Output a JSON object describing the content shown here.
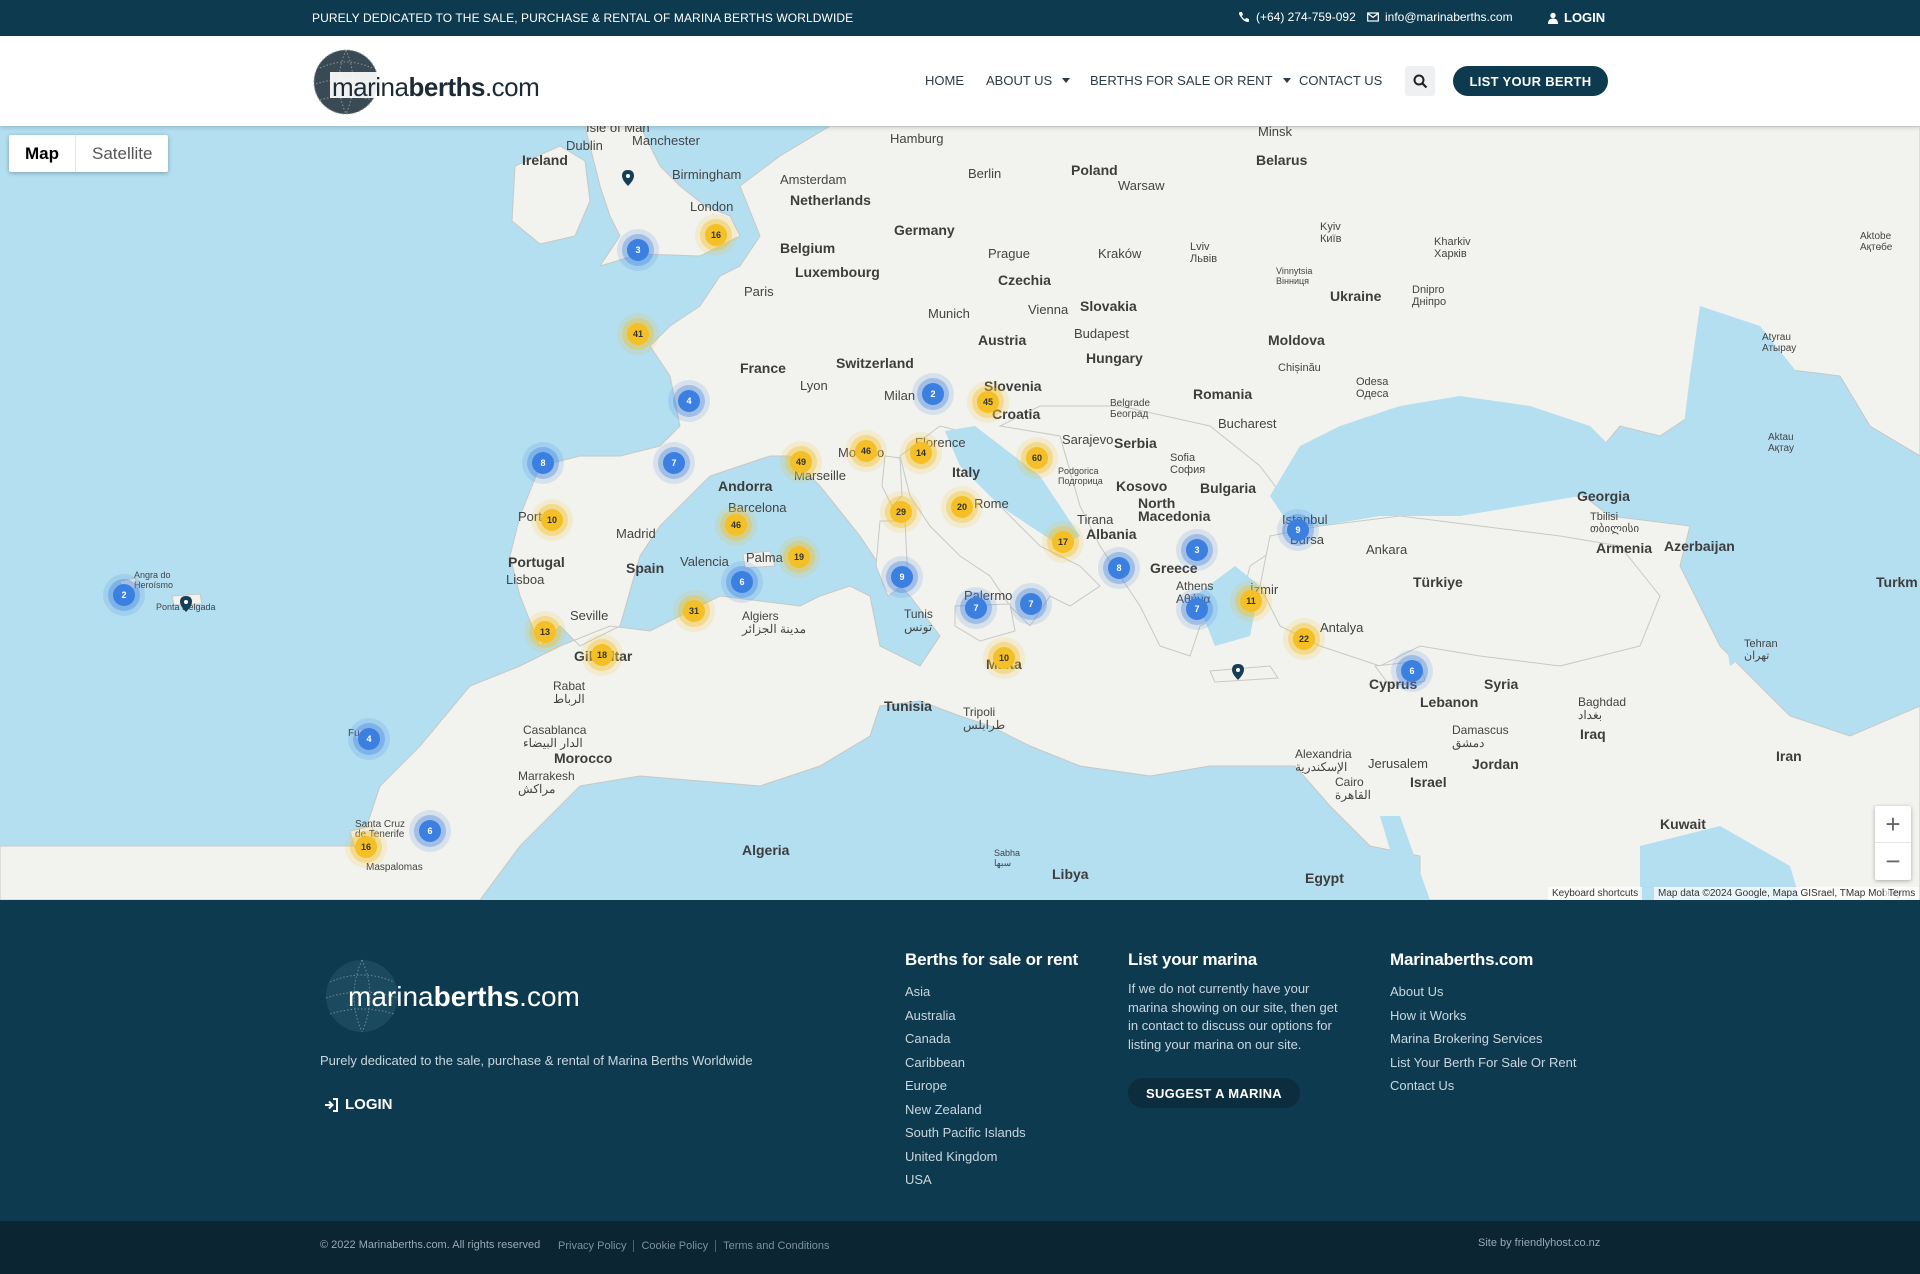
{
  "topbar": {
    "tagline": "PURELY DEDICATED TO THE SALE, PURCHASE & RENTAL OF MARINA BERTHS WORLDWIDE",
    "phone": "(+64) 274-759-092",
    "email": "info@marinaberths.com",
    "login": "LOGIN"
  },
  "header": {
    "logo_light": "marina",
    "logo_bold": "berths",
    "logo_tld": ".com",
    "nav": {
      "home": "HOME",
      "about": "ABOUT US",
      "berths": "BERTHS FOR SALE OR RENT",
      "contact": "CONTACT US"
    },
    "list_button": "LIST YOUR BERTH",
    "search_icon": "search-icon"
  },
  "map": {
    "map_type": {
      "map": "Map",
      "satellite": "Satellite"
    },
    "labels": {
      "ireland": "Ireland",
      "dublin": "Dublin",
      "birmingham": "Birmingham",
      "london": "London",
      "manchester": "Manchester",
      "isle_of_man": "Isle of Man",
      "amsterdam": "Amsterdam",
      "netherlands": "Netherlands",
      "hamburg": "Hamburg",
      "berlin": "Berlin",
      "poland": "Poland",
      "warsaw": "Warsaw",
      "minsk": "Minsk",
      "belarus": "Belarus",
      "belgium": "Belgium",
      "luxembourg": "Luxembourg",
      "germany": "Germany",
      "prague": "Prague",
      "czechia": "Czechia",
      "krakow": "Kraków",
      "lviv": "Lviv\nЛьвів",
      "kyiv": "Kyiv\nКиїв",
      "kharkiv": "Kharkiv\nХарків",
      "vinnytsia": "Vinnytsia\nВінниця",
      "ukraine": "Ukraine",
      "dnipro": "Dnipro\nДніпро",
      "aktobe": "Aktobe\nАқтөбе",
      "paris": "Paris",
      "munich": "Munich",
      "vienna": "Vienna",
      "slovakia": "Slovakia",
      "austria": "Austria",
      "budapest": "Budapest",
      "hungary": "Hungary",
      "moldova": "Moldova",
      "chisinau": "Chișinău",
      "odesa": "Odesa\nОдеса",
      "atyrau": "Atyrau\nАтырау",
      "france": "France",
      "switzerland": "Switzerland",
      "lyon": "Lyon",
      "milan": "Milan",
      "slovenia": "Slovenia",
      "croatia": "Croatia",
      "romania": "Romania",
      "belgrade": "Belgrade\nБеоград",
      "bucharest": "Bucharest",
      "aktau": "Aktau\nАқтау",
      "florence": "Florence",
      "monaco": "Monaco",
      "sarajevo": "Sarajevo",
      "serbia": "Serbia",
      "marseille": "Marseille",
      "andorra": "Andorra",
      "italy": "Italy",
      "podgorica": "Podgorica\nПодгорица",
      "sofia": "Sofia\nСофия",
      "bulgaria": "Bulgaria",
      "kosovo": "Kosovo",
      "barcelona": "Barcelona",
      "rome": "Rome",
      "north_macedonia": "North\nMacedonia",
      "georgia": "Georgia",
      "tbilisi": "Tbilisi\nთბილისი",
      "porto": "Porto",
      "madrid": "Madrid",
      "tirana": "Tirana",
      "albania": "Albania",
      "istanbul": "Istanbul",
      "bursa": "Bursa",
      "ankara": "Ankara",
      "armenia": "Armenia",
      "azerbaijan": "Azerbaijan",
      "portugal": "Portugal",
      "lisbon": "Lisboa",
      "spain": "Spain",
      "valencia": "Valencia",
      "palma": "Palma",
      "greece": "Greece",
      "izmir": "İzmir",
      "turkiye": "Türkiye",
      "turkm": "Turkm",
      "angra": "Angra do\nHeroísmo",
      "ponta_delgada": "Ponta Delgada",
      "seville": "Seville",
      "algiers": "Algiers\nمدينة الجزائر",
      "tunis": "Tunis\nتونس",
      "palermo": "Palermo",
      "athens": "Athens\nΑθήνα",
      "antalya": "Antalya",
      "tehran": "Tehran\nتهران",
      "gibraltar": "Gibraltar",
      "malta": "Malta",
      "cyprus": "Cyprus",
      "syria": "Syria",
      "lebanon": "Lebanon",
      "rabat": "Rabat\nالرباط",
      "tunisia": "Tunisia",
      "tripoli": "Tripoli\nطرابلس",
      "damascus": "Damascus\nدمشق",
      "baghdad": "Baghdad\nبغداد",
      "iraq": "Iraq",
      "casablanca": "Casablanca\nالدار البيضاء",
      "morocco": "Morocco",
      "marrakesh": "Marrakesh\nمراكش",
      "alexandria": "Alexandria\nالإسكندرية",
      "jerusalem": "Jerusalem",
      "israel": "Israel",
      "jordan": "Jordan",
      "iran": "Iran",
      "cairo": "Cairo\nالقاهرة",
      "kuwait": "Kuwait",
      "santa_cruz": "Santa Cruz\nde Tenerife",
      "maspalomas": "Maspalomas",
      "algeria": "Algeria",
      "libya": "Libya",
      "egypt": "Egypt",
      "sabha": "Sabha\nسبها",
      "funchal": "Fu"
    },
    "clusters": [
      {
        "label": "3",
        "color": "blue"
      },
      {
        "label": "16",
        "color": "yellow"
      },
      {
        "label": "41",
        "color": "yellow"
      },
      {
        "label": "4",
        "color": "blue"
      },
      {
        "label": "2",
        "color": "blue"
      },
      {
        "label": "45",
        "color": "yellow"
      },
      {
        "label": "8",
        "color": "blue"
      },
      {
        "label": "7",
        "color": "blue"
      },
      {
        "label": "49",
        "color": "yellow"
      },
      {
        "label": "46",
        "color": "yellow"
      },
      {
        "label": "14",
        "color": "yellow"
      },
      {
        "label": "60",
        "color": "yellow"
      },
      {
        "label": "10",
        "color": "yellow"
      },
      {
        "label": "46",
        "color": "yellow"
      },
      {
        "label": "29",
        "color": "yellow"
      },
      {
        "label": "20",
        "color": "yellow"
      },
      {
        "label": "17",
        "color": "yellow"
      },
      {
        "label": "9",
        "color": "blue"
      },
      {
        "label": "3",
        "color": "blue"
      },
      {
        "label": "19",
        "color": "yellow"
      },
      {
        "label": "6",
        "color": "blue"
      },
      {
        "label": "9",
        "color": "blue"
      },
      {
        "label": "8",
        "color": "blue"
      },
      {
        "label": "2",
        "color": "blue"
      },
      {
        "label": "13",
        "color": "yellow"
      },
      {
        "label": "31",
        "color": "yellow"
      },
      {
        "label": "7",
        "color": "blue"
      },
      {
        "label": "7",
        "color": "blue"
      },
      {
        "label": "7",
        "color": "blue"
      },
      {
        "label": "11",
        "color": "yellow"
      },
      {
        "label": "18",
        "color": "yellow"
      },
      {
        "label": "22",
        "color": "yellow"
      },
      {
        "label": "10",
        "color": "yellow"
      },
      {
        "label": "6",
        "color": "blue"
      },
      {
        "label": "4",
        "color": "blue"
      },
      {
        "label": "6",
        "color": "blue"
      },
      {
        "label": "16",
        "color": "yellow"
      }
    ],
    "zoom_in": "+",
    "zoom_out": "−",
    "keyboard": "Keyboard shortcuts",
    "map_data": "Map data ©2024 Google, Mapa GISrael, TMap Mobility",
    "terms": "Terms"
  },
  "footer": {
    "tagline": "Purely dedicated to the sale, purchase & rental of Marina Berths Worldwide",
    "login": "LOGIN",
    "berths_col": {
      "title": "Berths for sale or rent",
      "items": [
        "Asia",
        "Australia",
        "Canada",
        "Caribbean",
        "Europe",
        "New Zealand",
        "South Pacific Islands",
        "United Kingdom",
        "USA"
      ]
    },
    "list_col": {
      "title": "List your marina",
      "text": "If we do not currently have your marina showing on our site, then get in contact to discuss our options for listing your marina on our site.",
      "button": "SUGGEST A MARINA"
    },
    "site_col": {
      "title": "Marinaberths.com",
      "items": [
        "About Us",
        "How it Works",
        "Marina Brokering Services",
        "List Your Berth For Sale Or Rent",
        "Contact Us"
      ]
    },
    "copyright": "© 2022 Marinaberths.com. All rights reserved",
    "legal": [
      "Privacy Policy",
      "Cookie Policy",
      "Terms and Conditions"
    ],
    "credit": "Site by friendlyhost.co.nz"
  },
  "colors": {
    "brand": "#0e3a4f",
    "cluster_blue": "#3b7fe0",
    "cluster_yellow": "#f4c025",
    "sea": "#b3dff1"
  }
}
